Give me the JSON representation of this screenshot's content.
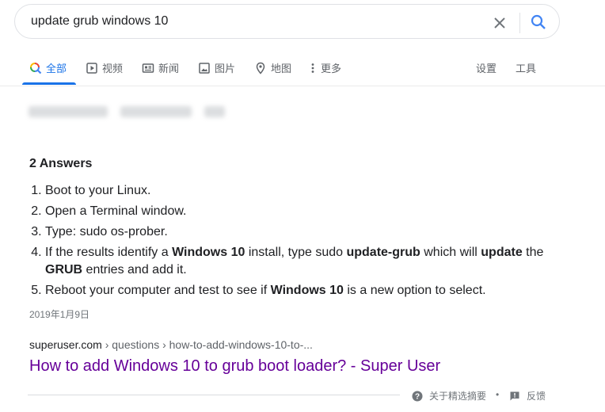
{
  "search": {
    "query": "update grub windows 10"
  },
  "tabs": {
    "all": "全部",
    "videos": "视频",
    "news": "新闻",
    "images": "图片",
    "maps": "地图",
    "more": "更多",
    "settings": "设置",
    "tools": "工具"
  },
  "snippet": {
    "answers_title": "2 Answers",
    "steps": {
      "s1": "Boot to your Linux.",
      "s2": "Open a Terminal window.",
      "s3": "Type: sudo os-prober.",
      "s4": {
        "p1": "If the results identify a ",
        "b1": "Windows 10",
        "p2": " install, type sudo ",
        "b2": "update-grub",
        "p3": " which will ",
        "b3": "update",
        "p4": " the ",
        "b4": "GRUB",
        "p5": " entries and add it."
      },
      "s5": {
        "p1": "Reboot your computer and test to see if ",
        "b1": "Windows 10",
        "p2": " is a new option to select."
      }
    },
    "date": "2019年1月9日"
  },
  "result": {
    "domain": "superuser.com",
    "path": " › questions › how-to-add-windows-10-to-...",
    "title": "How to add Windows 10 to grub boot loader? - Super User"
  },
  "footer": {
    "about": "关于精选摘要",
    "separator": "•",
    "feedback": "反馈"
  },
  "colors": {
    "accent": "#1a73e8",
    "visited_link": "#660099",
    "muted": "#5f6368"
  }
}
